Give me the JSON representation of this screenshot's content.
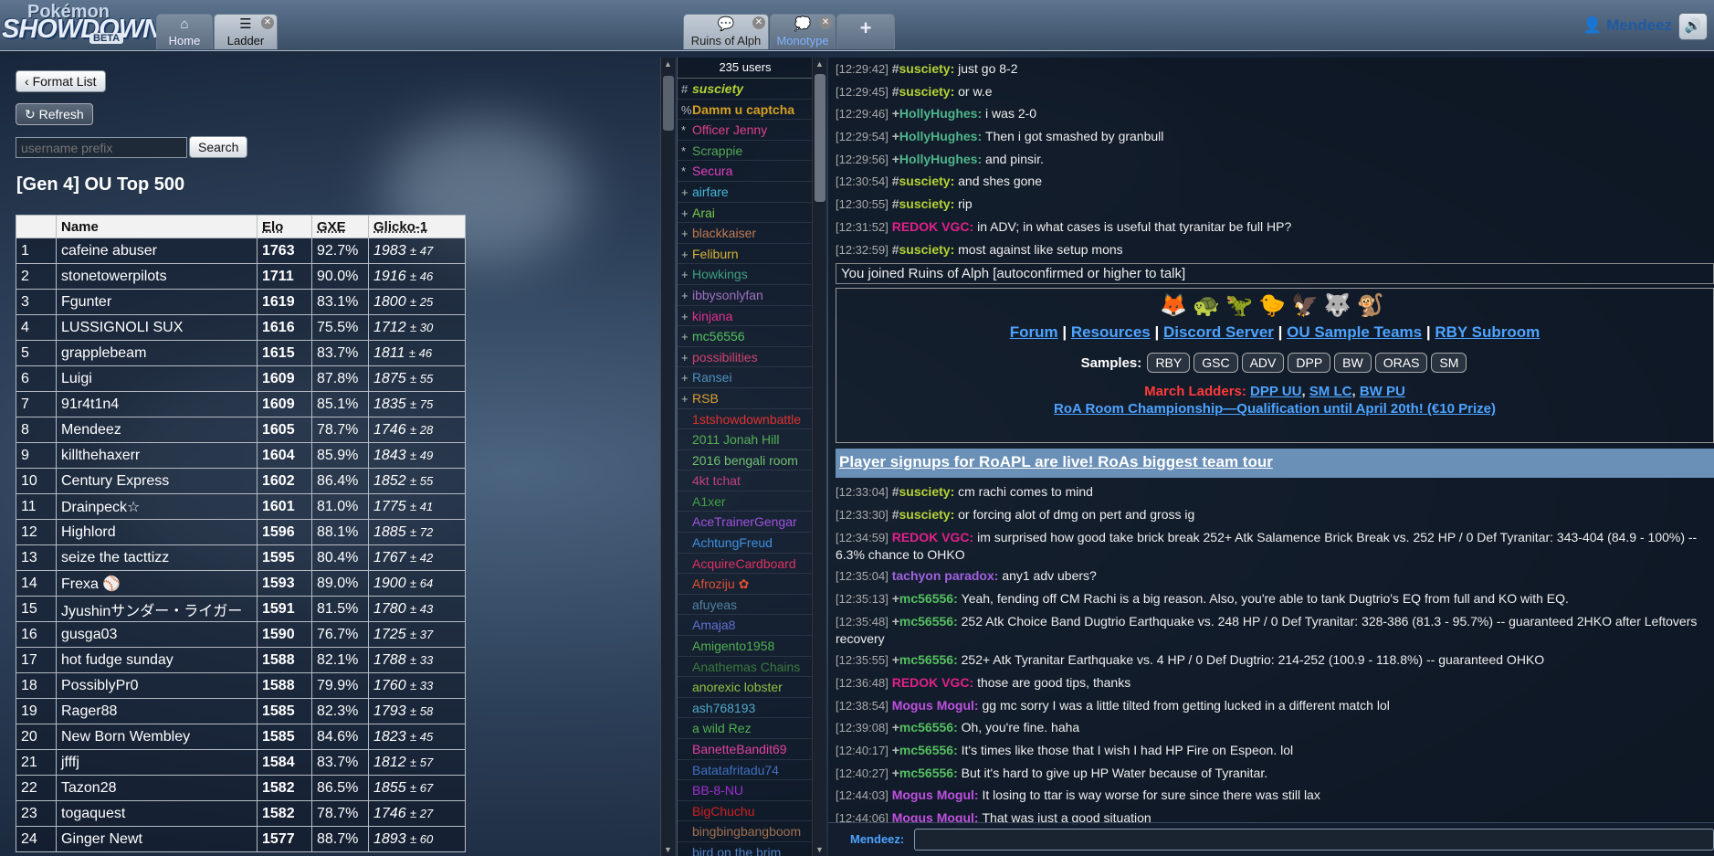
{
  "header": {
    "logo_line1": "Pokémon",
    "logo_line2": "SHOWDOWN!",
    "logo_line3": "BETA",
    "tabs": [
      {
        "label": "Home",
        "icon": "home-icon"
      },
      {
        "label": "Ladder",
        "icon": "list-icon"
      },
      {
        "label": "Ruins of Alph",
        "icon": "chat-icon"
      },
      {
        "label": "Monotype",
        "icon": "chat-bubbles-icon"
      },
      {
        "label": "+",
        "icon": "plus-icon"
      }
    ],
    "username": "Mendeez",
    "sound_icon": "speaker-icon"
  },
  "ladder": {
    "format_list_label": "Format List",
    "refresh_label": "Refresh",
    "search_placeholder": "username prefix",
    "search_button": "Search",
    "title": "[Gen 4] OU Top 500",
    "columns": [
      "",
      "Name",
      "Elo",
      "GXE",
      "Glicko-1"
    ],
    "rows": [
      {
        "rank": "1",
        "name": "cafeine abuser",
        "elo": "1763",
        "gxe": "92.7%",
        "glicko": "1983",
        "dev": "± 47"
      },
      {
        "rank": "2",
        "name": "stonetowerpilots",
        "elo": "1711",
        "gxe": "90.0%",
        "glicko": "1916",
        "dev": "± 46"
      },
      {
        "rank": "3",
        "name": "Fgunter",
        "elo": "1619",
        "gxe": "83.1%",
        "glicko": "1800",
        "dev": "± 25"
      },
      {
        "rank": "4",
        "name": "LUSSIGNOLI SUX",
        "elo": "1616",
        "gxe": "75.5%",
        "glicko": "1712",
        "dev": "± 30"
      },
      {
        "rank": "5",
        "name": "grapplebeam",
        "elo": "1615",
        "gxe": "83.7%",
        "glicko": "1811",
        "dev": "± 46"
      },
      {
        "rank": "6",
        "name": "Luigi",
        "elo": "1609",
        "gxe": "87.8%",
        "glicko": "1875",
        "dev": "± 55"
      },
      {
        "rank": "7",
        "name": "91r4t1n4",
        "elo": "1609",
        "gxe": "85.1%",
        "glicko": "1835",
        "dev": "± 75"
      },
      {
        "rank": "8",
        "name": "Mendeez",
        "elo": "1605",
        "gxe": "78.7%",
        "glicko": "1746",
        "dev": "± 28"
      },
      {
        "rank": "9",
        "name": "killthehaxerr",
        "elo": "1604",
        "gxe": "85.9%",
        "glicko": "1843",
        "dev": "± 49"
      },
      {
        "rank": "10",
        "name": "Century Express",
        "elo": "1602",
        "gxe": "86.4%",
        "glicko": "1852",
        "dev": "± 55"
      },
      {
        "rank": "11",
        "name": "Drainpeck☆",
        "elo": "1601",
        "gxe": "81.0%",
        "glicko": "1775",
        "dev": "± 41"
      },
      {
        "rank": "12",
        "name": "Highlord",
        "elo": "1596",
        "gxe": "88.1%",
        "glicko": "1885",
        "dev": "± 72"
      },
      {
        "rank": "13",
        "name": "seize the tacttizz",
        "elo": "1595",
        "gxe": "80.4%",
        "glicko": "1767",
        "dev": "± 42"
      },
      {
        "rank": "14",
        "name": "Frexa ⚾",
        "elo": "1593",
        "gxe": "89.0%",
        "glicko": "1900",
        "dev": "± 64"
      },
      {
        "rank": "15",
        "name": "Jyushinサンダー・ライガー",
        "elo": "1591",
        "gxe": "81.5%",
        "glicko": "1780",
        "dev": "± 43"
      },
      {
        "rank": "16",
        "name": "gusga03",
        "elo": "1590",
        "gxe": "76.7%",
        "glicko": "1725",
        "dev": "± 37"
      },
      {
        "rank": "17",
        "name": "hot fudge sunday",
        "elo": "1588",
        "gxe": "82.1%",
        "glicko": "1788",
        "dev": "± 33"
      },
      {
        "rank": "18",
        "name": "PossiblyPr0",
        "elo": "1588",
        "gxe": "79.9%",
        "glicko": "1760",
        "dev": "± 33"
      },
      {
        "rank": "19",
        "name": "Rager88",
        "elo": "1585",
        "gxe": "82.3%",
        "glicko": "1793",
        "dev": "± 58"
      },
      {
        "rank": "20",
        "name": "New Born Wembley",
        "elo": "1585",
        "gxe": "84.6%",
        "glicko": "1823",
        "dev": "± 45"
      },
      {
        "rank": "21",
        "name": "jfffj",
        "elo": "1584",
        "gxe": "83.7%",
        "glicko": "1812",
        "dev": "± 57"
      },
      {
        "rank": "22",
        "name": "Tazon28",
        "elo": "1582",
        "gxe": "86.5%",
        "glicko": "1855",
        "dev": "± 67"
      },
      {
        "rank": "23",
        "name": "togaquest",
        "elo": "1582",
        "gxe": "78.7%",
        "glicko": "1746",
        "dev": "± 27"
      },
      {
        "rank": "24",
        "name": "Ginger Newt",
        "elo": "1577",
        "gxe": "88.7%",
        "glicko": "1893",
        "dev": "± 60"
      }
    ]
  },
  "userlist": {
    "count": "235 users",
    "users": [
      {
        "rank": "#",
        "name": "susciety",
        "color": "#b5d334",
        "style": "italic-bold"
      },
      {
        "rank": "%",
        "name": "Damm u captcha",
        "color": "#d6a020",
        "style": "bold"
      },
      {
        "rank": "*",
        "name": "Officer Jenny",
        "color": "#e0408a",
        "style": ""
      },
      {
        "rank": "*",
        "name": "Scrappie",
        "color": "#55a855",
        "style": ""
      },
      {
        "rank": "*",
        "name": "Secura",
        "color": "#e040c0",
        "style": ""
      },
      {
        "rank": "+",
        "name": "airfare",
        "color": "#46b8d8",
        "style": ""
      },
      {
        "rank": "+",
        "name": "Arai",
        "color": "#7ac94d",
        "style": ""
      },
      {
        "rank": "+",
        "name": "blackkaiser",
        "color": "#c07a50",
        "style": ""
      },
      {
        "rank": "+",
        "name": "Feliburn",
        "color": "#d8b030",
        "style": ""
      },
      {
        "rank": "+",
        "name": "Howkings",
        "color": "#3fa080",
        "style": ""
      },
      {
        "rank": "+",
        "name": "ibbysonlyfan",
        "color": "#a070c0",
        "style": ""
      },
      {
        "rank": "+",
        "name": "kinjana",
        "color": "#e03090",
        "style": ""
      },
      {
        "rank": "+",
        "name": "mc56556",
        "color": "#55c060",
        "style": ""
      },
      {
        "rank": "+",
        "name": "possibilities",
        "color": "#d04070",
        "style": ""
      },
      {
        "rank": "+",
        "name": "Ransei",
        "color": "#5090c0",
        "style": ""
      },
      {
        "rank": "+",
        "name": "RSB",
        "color": "#d8a030",
        "style": ""
      },
      {
        "rank": "",
        "name": "1stshowdownbattle",
        "color": "#e03030",
        "style": ""
      },
      {
        "rank": "",
        "name": "2011 Jonah Hill",
        "color": "#55b055",
        "style": ""
      },
      {
        "rank": "",
        "name": "2016 bengali room",
        "color": "#70c070",
        "style": ""
      },
      {
        "rank": "",
        "name": "4kt tchat",
        "color": "#c04080",
        "style": ""
      },
      {
        "rank": "",
        "name": "A1xer",
        "color": "#40a040",
        "style": ""
      },
      {
        "rank": "",
        "name": "AceTrainerGengar",
        "color": "#a050e0",
        "style": ""
      },
      {
        "rank": "",
        "name": "AchtungFreud",
        "color": "#4090e0",
        "style": ""
      },
      {
        "rank": "",
        "name": "AcquireCardboard",
        "color": "#e03060",
        "style": ""
      },
      {
        "rank": "",
        "name": "Afroziju ✿",
        "color": "#e05030",
        "style": ""
      },
      {
        "rank": "",
        "name": "afuyeas",
        "color": "#5080a0",
        "style": ""
      },
      {
        "rank": "",
        "name": "Amaja8",
        "color": "#6070d0",
        "style": ""
      },
      {
        "rank": "",
        "name": "Amigento1958",
        "color": "#50b050",
        "style": ""
      },
      {
        "rank": "",
        "name": "Anathemas Chains",
        "color": "#3a7a3a",
        "style": ""
      },
      {
        "rank": "",
        "name": "anorexic lobster",
        "color": "#90c040",
        "style": ""
      },
      {
        "rank": "",
        "name": "ash768193",
        "color": "#50a8c8",
        "style": ""
      },
      {
        "rank": "",
        "name": "a wild Rez",
        "color": "#50b050",
        "style": ""
      },
      {
        "rank": "",
        "name": "BanetteBandit69",
        "color": "#e040a0",
        "style": ""
      },
      {
        "rank": "",
        "name": "Batatafritadu74",
        "color": "#4070c0",
        "style": ""
      },
      {
        "rank": "",
        "name": "BB-8-NU",
        "color": "#a030d0",
        "style": ""
      },
      {
        "rank": "",
        "name": "BigChuchu",
        "color": "#d02020",
        "style": ""
      },
      {
        "rank": "",
        "name": "bingbingbangboom",
        "color": "#a07050",
        "style": ""
      },
      {
        "rank": "",
        "name": "bird on the brim",
        "color": "#5080c0",
        "style": ""
      }
    ]
  },
  "chat": {
    "messages_top": [
      {
        "ts": "[12:29:42]",
        "rank": "#",
        "name": "susciety",
        "color": "#b5d334",
        "text": "just go 8-2"
      },
      {
        "ts": "[12:29:45]",
        "rank": "#",
        "name": "susciety",
        "color": "#b5d334",
        "text": "or w.e"
      },
      {
        "ts": "[12:29:46]",
        "rank": "+",
        "name": "HollyHughes",
        "color": "#4fb58a",
        "text": "i was 2-0"
      },
      {
        "ts": "[12:29:54]",
        "rank": "+",
        "name": "HollyHughes",
        "color": "#4fb58a",
        "text": "Then i got smashed by granbull"
      },
      {
        "ts": "[12:29:56]",
        "rank": "+",
        "name": "HollyHughes",
        "color": "#4fb58a",
        "text": "and pinsir."
      },
      {
        "ts": "[12:30:54]",
        "rank": "#",
        "name": "susciety",
        "color": "#b5d334",
        "text": "and shes gone"
      },
      {
        "ts": "[12:30:55]",
        "rank": "#",
        "name": "susciety",
        "color": "#b5d334",
        "text": "rip"
      },
      {
        "ts": "[12:31:52]",
        "rank": "",
        "name": "REDOK VGC",
        "color": "#e0208a",
        "text": "in ADV; in what cases is useful that tyranitar be full HP?"
      },
      {
        "ts": "[12:32:59]",
        "rank": "#",
        "name": "susciety",
        "color": "#b5d334",
        "text": "most against like setup mons"
      }
    ],
    "join_notice": "You joined Ruins of Alph [autoconfirmed or higher to talk]",
    "infobox": {
      "sprites": [
        "🦊",
        "🐢",
        "🦖",
        "🐤",
        "🦅",
        "🐺",
        "🐒"
      ],
      "links": [
        "Forum",
        "Resources",
        "Discord Server",
        "OU Sample Teams",
        "RBY Subroom"
      ],
      "samples_label": "Samples:",
      "samples": [
        "RBY",
        "GSC",
        "ADV",
        "DPP",
        "BW",
        "ORAS",
        "SM"
      ],
      "march_label": "March Ladders:",
      "march_links": [
        "DPP UU",
        "SM LC",
        "BW PU"
      ],
      "championship": "RoA Room Championship—Qualification until April 20th! (€10 Prize)"
    },
    "banner": "Player signups for RoAPL are live! RoAs biggest team tour",
    "messages_bottom": [
      {
        "ts": "[12:33:04]",
        "rank": "#",
        "name": "susciety",
        "color": "#b5d334",
        "text": "cm rachi comes to mind"
      },
      {
        "ts": "[12:33:30]",
        "rank": "#",
        "name": "susciety",
        "color": "#b5d334",
        "text": "or forcing alot of dmg on pert and gross ig"
      },
      {
        "ts": "[12:34:59]",
        "rank": "",
        "name": "REDOK VGC",
        "color": "#e0208a",
        "text": "im surprised how good take brick break 252+ Atk Salamence Brick Break vs. 252 HP / 0 Def Tyranitar: 343-404 (84.9 - 100%) -- 6.3% chance to OHKO"
      },
      {
        "ts": "[12:35:04]",
        "rank": "",
        "name": "tachyon paradox",
        "color": "#a060e0",
        "text": "any1 adv ubers?"
      },
      {
        "ts": "[12:35:13]",
        "rank": "+",
        "name": "mc56556",
        "color": "#55c060",
        "text": "Yeah, fending off CM Rachi is a big reason. Also, you're able to tank Dugtrio's EQ from full and KO with EQ."
      },
      {
        "ts": "[12:35:48]",
        "rank": "+",
        "name": "mc56556",
        "color": "#55c060",
        "text": "252 Atk Choice Band Dugtrio Earthquake vs. 248 HP / 0 Def Tyranitar: 328-386 (81.3 - 95.7%) -- guaranteed 2HKO after Leftovers recovery"
      },
      {
        "ts": "[12:35:55]",
        "rank": "+",
        "name": "mc56556",
        "color": "#55c060",
        "text": "252+ Atk Tyranitar Earthquake vs. 4 HP / 0 Def Dugtrio: 214-252 (100.9 - 118.8%) -- guaranteed OHKO"
      },
      {
        "ts": "[12:36:48]",
        "rank": "",
        "name": "REDOK VGC",
        "color": "#e0208a",
        "text": "those are good tips, thanks"
      },
      {
        "ts": "[12:38:54]",
        "rank": "",
        "name": "Mogus Mogul",
        "color": "#c050e0",
        "text": "gg mc sorry I was a little tilted from getting lucked in a different match lol"
      },
      {
        "ts": "[12:39:08]",
        "rank": "+",
        "name": "mc56556",
        "color": "#55c060",
        "text": "Oh, you're fine. haha"
      },
      {
        "ts": "[12:40:17]",
        "rank": "+",
        "name": "mc56556",
        "color": "#55c060",
        "text": "It's times like those that I wish I had HP Fire on Espeon. lol"
      },
      {
        "ts": "[12:40:27]",
        "rank": "+",
        "name": "mc56556",
        "color": "#55c060",
        "text": "But it's hard to give up HP Water because of Tyranitar."
      },
      {
        "ts": "[12:44:03]",
        "rank": "",
        "name": "Mogus Mogul",
        "color": "#c050e0",
        "text": "It losing to ttar is way worse for sure since there was still lax"
      },
      {
        "ts": "[12:44:06]",
        "rank": "",
        "name": "Mogus Mogul",
        "color": "#c050e0",
        "text": "That was just a good situation"
      }
    ],
    "input_user": "Mendeez:"
  }
}
